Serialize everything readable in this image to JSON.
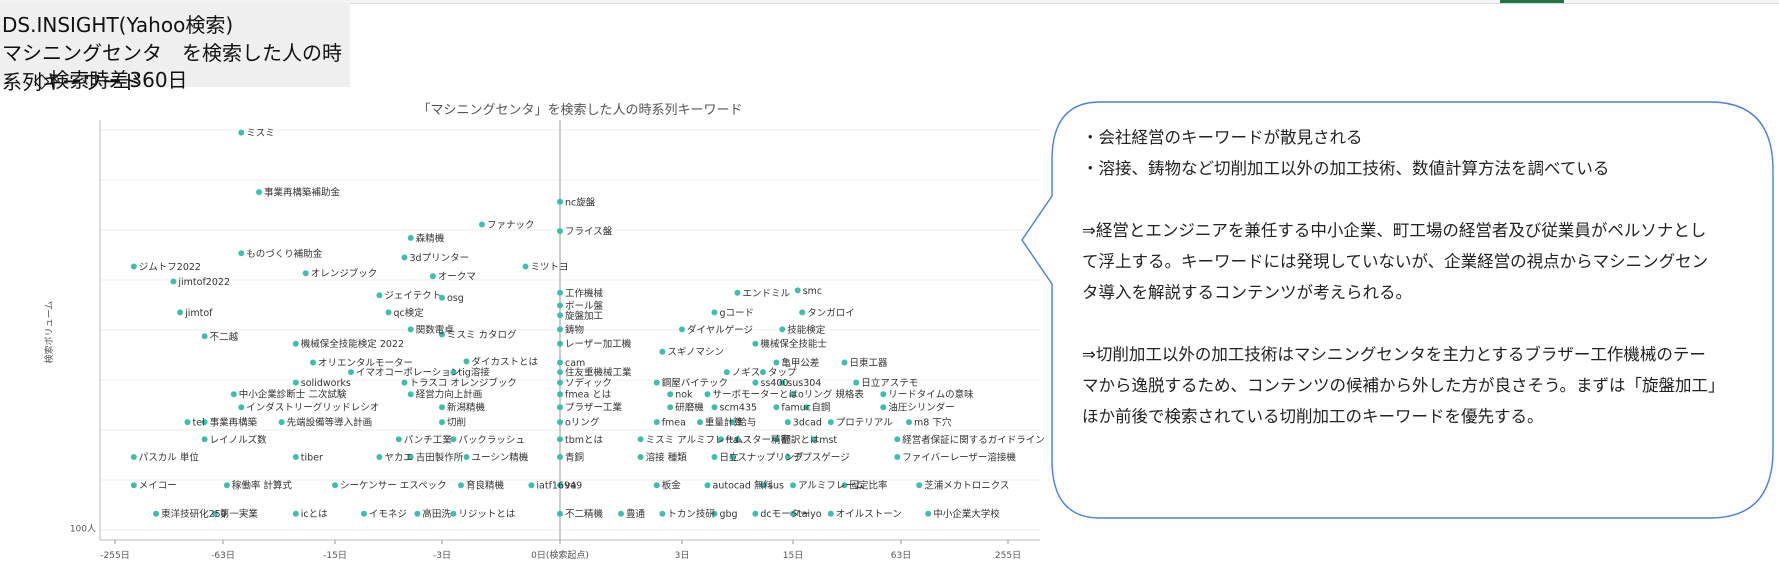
{
  "header": {
    "title": "DS.INSIGHT(Yahoo検索)",
    "subtitle": "マシニングセンタ　を検索した人の時系列キーワード",
    "lag": "◇検索時差360日"
  },
  "chart_data": {
    "type": "scatter",
    "title": "「マシニングセンタ」を検索した人の時系列キーワード",
    "xlabel": "",
    "ylabel": "検索ボリューム",
    "x_ticks": [
      "-255日",
      "-63日",
      "-15日",
      "-3日",
      "0日(検索起点)",
      "3日",
      "15日",
      "63日",
      "255日"
    ],
    "y_ticks": [
      "100人"
    ],
    "x_scale": "symlog",
    "y_scale": "log",
    "grid": true,
    "marker_color": "#3fbfaa",
    "labeled_points": [
      {
        "label": "ミスミ",
        "x": -50,
        "y": 4000
      },
      {
        "label": "事業再構築補助金",
        "x": -40,
        "y": 2300
      },
      {
        "label": "nc旋盤",
        "x": 0,
        "y": 2100
      },
      {
        "label": "ファナック",
        "x": -1.5,
        "y": 1700
      },
      {
        "label": "フライス盤",
        "x": 0,
        "y": 1600
      },
      {
        "label": "森精機",
        "x": -5,
        "y": 1500
      },
      {
        "label": "ものづくり補助金",
        "x": -50,
        "y": 1300
      },
      {
        "label": "3dプリンター",
        "x": -5.5,
        "y": 1250
      },
      {
        "label": "ジムトフ2022",
        "x": -200,
        "y": 1150
      },
      {
        "label": "ミツトヨ",
        "x": -0.5,
        "y": 1150
      },
      {
        "label": "オレンジブック",
        "x": -22,
        "y": 1080
      },
      {
        "label": "オークマ",
        "x": -3.5,
        "y": 1050
      },
      {
        "label": "jimtof2022",
        "x": -120,
        "y": 1000
      },
      {
        "label": "工作機械",
        "x": 0,
        "y": 900
      },
      {
        "label": "エンドミル",
        "x": 7,
        "y": 900
      },
      {
        "label": "smc",
        "x": 16,
        "y": 920
      },
      {
        "label": "ジェイテクト",
        "x": -8,
        "y": 880
      },
      {
        "label": "osg",
        "x": -3,
        "y": 860
      },
      {
        "label": "ボール盤",
        "x": 0,
        "y": 800
      },
      {
        "label": "旋盤加工",
        "x": 0,
        "y": 730
      },
      {
        "label": "gコード",
        "x": 5,
        "y": 750
      },
      {
        "label": "タンガロイ",
        "x": 17,
        "y": 750
      },
      {
        "label": "jimtof",
        "x": -110,
        "y": 750
      },
      {
        "label": "qc検定",
        "x": -7,
        "y": 750
      },
      {
        "label": "関数電卓",
        "x": -5,
        "y": 640
      },
      {
        "label": "鋳物",
        "x": 0,
        "y": 640
      },
      {
        "label": "ダイヤルゲージ",
        "x": 3,
        "y": 640
      },
      {
        "label": "技能検定",
        "x": 13,
        "y": 640
      },
      {
        "label": "不二越",
        "x": -80,
        "y": 600
      },
      {
        "label": "ミスミ カタログ",
        "x": -3,
        "y": 610
      },
      {
        "label": "レーザー加工機",
        "x": 0,
        "y": 560
      },
      {
        "label": "機械保全技能検定 2022",
        "x": -25,
        "y": 560
      },
      {
        "label": "機械保全技能士",
        "x": 9,
        "y": 560
      },
      {
        "label": "スギノマシン",
        "x": 2.2,
        "y": 520
      },
      {
        "label": "オリエンタルモーター",
        "x": -20,
        "y": 470
      },
      {
        "label": "ダイカストとは",
        "x": -2,
        "y": 475
      },
      {
        "label": "cam",
        "x": 0,
        "y": 470
      },
      {
        "label": "亀甲公差",
        "x": 12,
        "y": 470
      },
      {
        "label": "日東工器",
        "x": 30,
        "y": 470
      },
      {
        "label": "イマオコーポレーション",
        "x": -12,
        "y": 430
      },
      {
        "label": "tig溶接",
        "x": -2.5,
        "y": 430
      },
      {
        "label": "住友重機械工業",
        "x": 0,
        "y": 430
      },
      {
        "label": "ノギス",
        "x": 6,
        "y": 430
      },
      {
        "label": "タップ",
        "x": 10,
        "y": 430
      },
      {
        "label": "solidworks",
        "x": -25,
        "y": 390
      },
      {
        "label": "トラスコ オレンジブック",
        "x": -5.5,
        "y": 390
      },
      {
        "label": "ソディック",
        "x": 0,
        "y": 390
      },
      {
        "label": "鋼屋バイテック",
        "x": 2,
        "y": 390
      },
      {
        "label": "ss400",
        "x": 9,
        "y": 390
      },
      {
        "label": "sus304",
        "x": 13,
        "y": 390
      },
      {
        "label": "日立アステモ",
        "x": 35,
        "y": 390
      },
      {
        "label": "中小企業診断士 二次試験",
        "x": -55,
        "y": 350
      },
      {
        "label": "経営力向上計画",
        "x": -5,
        "y": 350
      },
      {
        "label": "fmea とは",
        "x": 0,
        "y": 350
      },
      {
        "label": "nok",
        "x": 2.5,
        "y": 350
      },
      {
        "label": "サーボモーターとは",
        "x": 4.5,
        "y": 350
      },
      {
        "label": "oリング 規格表",
        "x": 15,
        "y": 350
      },
      {
        "label": "リードタイムの意味",
        "x": 50,
        "y": 350
      },
      {
        "label": "インダストリーグリッドレシオ",
        "x": -50,
        "y": 310
      },
      {
        "label": "新潟精機",
        "x": -3,
        "y": 310
      },
      {
        "label": "プラザー工業",
        "x": 0,
        "y": 310
      },
      {
        "label": "研磨機",
        "x": 2.5,
        "y": 310
      },
      {
        "label": "scm435",
        "x": 5,
        "y": 310
      },
      {
        "label": "famuc",
        "x": 12,
        "y": 310
      },
      {
        "label": "自鋼",
        "x": 18,
        "y": 310
      },
      {
        "label": "油圧シリンダー",
        "x": 50,
        "y": 310
      },
      {
        "label": "tel",
        "x": -100,
        "y": 270
      },
      {
        "label": "事業再構築",
        "x": -80,
        "y": 270
      },
      {
        "label": "先端設備等導入計画",
        "x": -30,
        "y": 270
      },
      {
        "label": "切削",
        "x": -3,
        "y": 270
      },
      {
        "label": "oリング",
        "x": 0,
        "y": 270
      },
      {
        "label": "fmea",
        "x": 2,
        "y": 270
      },
      {
        "label": "重量計算",
        "x": 4,
        "y": 270
      },
      {
        "label": "給与",
        "x": 6.5,
        "y": 270
      },
      {
        "label": "3dcad",
        "x": 14,
        "y": 270
      },
      {
        "label": "プロテリアル",
        "x": 25,
        "y": 270
      },
      {
        "label": "m8 下穴",
        "x": 70,
        "y": 270
      },
      {
        "label": "レイノルズ数",
        "x": -80,
        "y": 230
      },
      {
        "label": "パンチ工業",
        "x": -6,
        "y": 230
      },
      {
        "label": "パックラッシュ",
        "x": -2.5,
        "y": 230
      },
      {
        "label": "tbmとは",
        "x": 0,
        "y": 230
      },
      {
        "label": "ミスミ アルミフレーム",
        "x": 1.5,
        "y": 230
      },
      {
        "label": "fta",
        "x": 5.5,
        "y": 230
      },
      {
        "label": "スター精密",
        "x": 7,
        "y": 230
      },
      {
        "label": "翻訳とは",
        "x": 12,
        "y": 230
      },
      {
        "label": "mst",
        "x": 20,
        "y": 230
      },
      {
        "label": "経営者保証に関するガイドライン",
        "x": 60,
        "y": 230
      },
      {
        "label": "パスカル 単位",
        "x": -200,
        "y": 195
      },
      {
        "label": "tiber",
        "x": -25,
        "y": 195
      },
      {
        "label": "ヤカエ",
        "x": -8,
        "y": 195
      },
      {
        "label": "吉田製作所",
        "x": -5,
        "y": 195
      },
      {
        "label": "ユーシン精機",
        "x": -2,
        "y": 195
      },
      {
        "label": "青銅",
        "x": 0,
        "y": 195
      },
      {
        "label": "溶接 種類",
        "x": 1.5,
        "y": 195
      },
      {
        "label": "日立",
        "x": 5,
        "y": 195
      },
      {
        "label": "スナップリング",
        "x": 6.5,
        "y": 195
      },
      {
        "label": "デプスゲージ",
        "x": 14,
        "y": 195
      },
      {
        "label": "ファイバーレーザー溶接機",
        "x": 60,
        "y": 195
      },
      {
        "label": "メイコー",
        "x": -200,
        "y": 150
      },
      {
        "label": "稼働率 計算式",
        "x": -60,
        "y": 150
      },
      {
        "label": "シーケンサー エスペック",
        "x": -15,
        "y": 150
      },
      {
        "label": "育良精機",
        "x": -2.2,
        "y": 150
      },
      {
        "label": "iatf16949",
        "x": -0.4,
        "y": 150
      },
      {
        "label": "va",
        "x": 0,
        "y": 150
      },
      {
        "label": "板金",
        "x": 2,
        "y": 150
      },
      {
        "label": "autocad 無料",
        "x": 4.5,
        "y": 150
      },
      {
        "label": "sus",
        "x": 10,
        "y": 150
      },
      {
        "label": "アルミフレーム",
        "x": 15,
        "y": 150
      },
      {
        "label": "固定比率",
        "x": 30,
        "y": 150
      },
      {
        "label": "芝浦メカトロニクス",
        "x": 80,
        "y": 150
      },
      {
        "label": "東洋技研化250",
        "x": -150,
        "y": 115
      },
      {
        "label": "第一実業",
        "x": -70,
        "y": 115
      },
      {
        "label": "icとは",
        "x": -25,
        "y": 115
      },
      {
        "label": "イモネジ",
        "x": -10,
        "y": 115
      },
      {
        "label": "高田洗",
        "x": -4.5,
        "y": 115
      },
      {
        "label": "リジットとは",
        "x": -2.5,
        "y": 115
      },
      {
        "label": "不二精機",
        "x": 0,
        "y": 115
      },
      {
        "label": "豊通",
        "x": 1,
        "y": 115
      },
      {
        "label": "トカン技研",
        "x": 2.2,
        "y": 115
      },
      {
        "label": "gbg",
        "x": 5,
        "y": 115
      },
      {
        "label": "dcモーター",
        "x": 9,
        "y": 115
      },
      {
        "label": "taiyo",
        "x": 15,
        "y": 115
      },
      {
        "label": "オイルストーン",
        "x": 25,
        "y": 115
      },
      {
        "label": "中小企業大学校",
        "x": 90,
        "y": 115
      }
    ]
  },
  "callout": {
    "lines": [
      "・会社経営のキーワードが散見される",
      "・溶接、鋳物など切削加工以外の加工技術、数値計算方法を調べている",
      "⇒経営とエンジニアを兼任する中小企業、町工場の経営者及び従業員がペルソナとして浮上する。キーワードには発現していないが、企業経営の視点からマシニングセンタ導入を解説するコンテンツが考えられる。",
      "⇒切削加工以外の加工技術はマシニングセンタを主力とするブラザー工作機械のテーマから逸脱するため、コンテンツの候補から外した方が良さそう。まずは「旋盤加工」ほか前後で検索されている切削加工のキーワードを優先する。"
    ],
    "border_color": "#4a7fd4"
  }
}
